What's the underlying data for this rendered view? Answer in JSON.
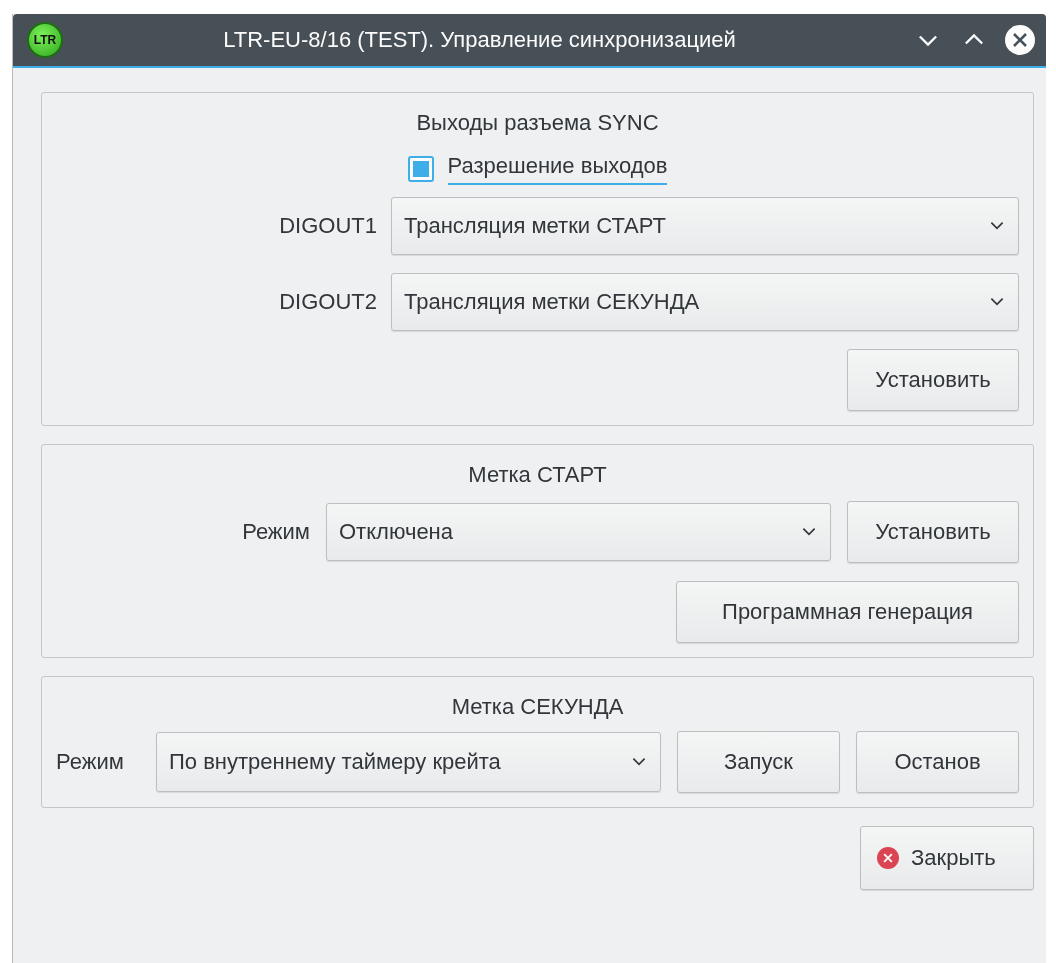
{
  "window": {
    "title": "LTR-EU-8/16 (TEST). Управление синхронизацией",
    "logo": "LTR"
  },
  "sync_outputs": {
    "title": "Выходы разъема SYNC",
    "enable": {
      "label": "Разрешение выходов",
      "checked": true
    },
    "outputs": [
      {
        "label": "DIGOUT1",
        "value": "Трансляция метки СТАРТ"
      },
      {
        "label": "DIGOUT2",
        "value": "Трансляция метки СЕКУНДА"
      }
    ],
    "set_button": "Установить"
  },
  "start_mark": {
    "title": "Метка СТАРТ",
    "mode_label": "Режим",
    "mode": "Отключена",
    "set_button": "Установить",
    "generate_button": "Программная генерация"
  },
  "second_mark": {
    "title": "Метка СЕКУНДА",
    "mode_label": "Режим",
    "mode": "По внутреннему таймеру крейта",
    "start_button": "Запуск",
    "stop_button": "Останов"
  },
  "close_button": "Закрыть"
}
